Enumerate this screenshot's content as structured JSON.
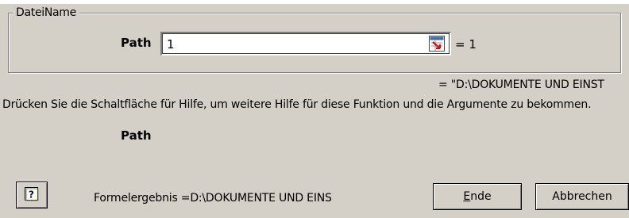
{
  "group": {
    "title": "DateiName"
  },
  "argument": {
    "label": "Path",
    "value": "1",
    "result": "= 1"
  },
  "function_result": "= \"D:\\DOKUMENTE UND EINST",
  "help_text": "Drücken Sie die Schaltfläche für Hilfe, um weitere Hilfe für diese Funktion und die Argumente zu bekommen.",
  "argument_description_label": "Path",
  "footer": {
    "formula_result": "Formelergebnis =D:\\DOKUMENTE UND EINS",
    "ok_label": "Ende",
    "cancel_label": "Abbrechen"
  },
  "icons": {
    "collapse": "range-collapse-icon",
    "help": "help-icon"
  }
}
